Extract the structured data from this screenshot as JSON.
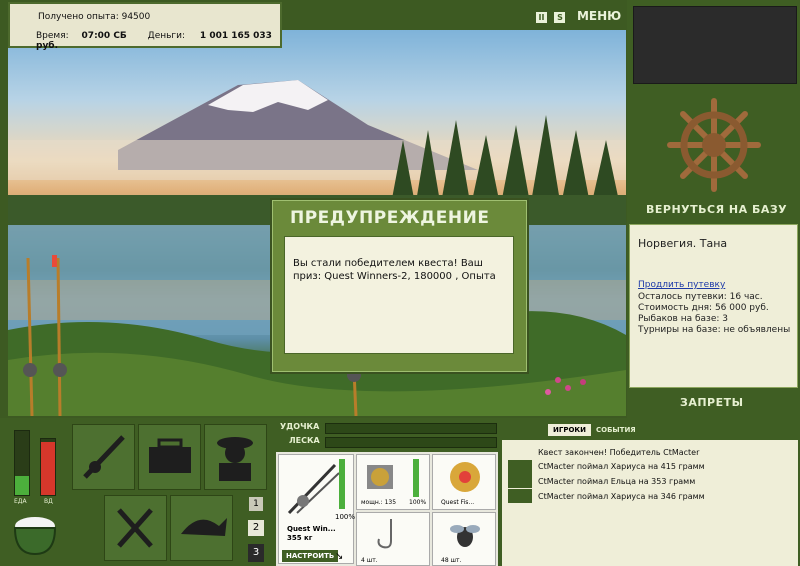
{
  "hud": {
    "experience_label": "Получено опыта: 94500",
    "time_label": "Время:",
    "time_value": "07:00 СБ",
    "money_label": "Деньги:",
    "money_value": "1 001 165 033 руб."
  },
  "top_menu": {
    "pause": "II",
    "sound": "S",
    "menu": "МЕНЮ"
  },
  "dialog": {
    "title": "ПРЕДУПРЕЖДЕНИЕ",
    "message": "Вы стали победителем квеста! Ваш приз: Quest Winners-2, 180000 , Опыта"
  },
  "right_panel": {
    "return_base": "ВЕРНУТЬСЯ НА БАЗУ",
    "location": "Норвегия. Тана",
    "extend_link": "Продлить путевку",
    "trip_left": "Осталось путевки: 16 час.",
    "day_cost": "Стоимость дня: 56 000 руб.",
    "fishers": "Рыбаков на базе: 3",
    "tournaments": "Турниры на базе: не объявлены",
    "bans": "ЗАПРЕТЫ"
  },
  "status_bars": {
    "food_label": "ЕДА",
    "fatigue_label": "ВД",
    "food_level": 0.3,
    "fatigue_level": 0.95
  },
  "pages": [
    "1",
    "2",
    "3"
  ],
  "gear": {
    "rod_label": "УДОЧКА",
    "line_label": "ЛЕСКА",
    "rod_name": "Quest Win...",
    "rod_weight": "355 кг",
    "rod_percent": "100%",
    "reel_label": "мощн.: 135",
    "reel_percent": "100%",
    "line_name": "Quest Fis...",
    "hook_count": "4 шт.",
    "bait_count": "48 шт.",
    "setup_button": "НАСТРОИТЬ"
  },
  "log": {
    "tab_players": "ИГРОКИ",
    "tab_events": "СОБЫТИЯ",
    "quest_done": "Квест закончен! Победитель CtMacter",
    "entries": [
      "CtMacter поймал Хариуса на 415 грамм",
      "CtMacter поймал Ельца на 353 грамм",
      "CtMacter поймал Хариуса на 346 грамм"
    ]
  },
  "colors": {
    "panel_green": "#3f5e23",
    "tile_green": "#4d7030",
    "fatigue_red": "#d6372b",
    "food_green": "#4caf3c"
  }
}
